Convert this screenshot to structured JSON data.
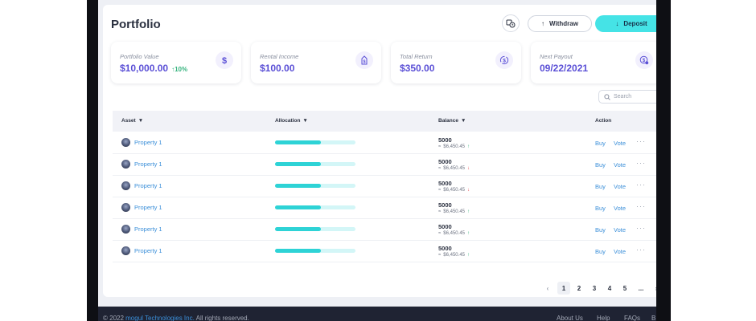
{
  "header": {
    "title": "Portfolio",
    "withdraw_label": "Withdraw",
    "deposit_label": "Deposit"
  },
  "stats": [
    {
      "label": "Portfolio Value",
      "value": "$10,000.00",
      "change": "10%",
      "icon": "dollar-icon"
    },
    {
      "label": "Rental Income",
      "value": "$100.00",
      "icon": "dollar-tag-icon"
    },
    {
      "label": "Total Return",
      "value": "$350.00",
      "icon": "dollar-cycle-icon"
    },
    {
      "label": "Next Payout",
      "value": "09/22/2021",
      "icon": "dollar-clock-icon"
    }
  ],
  "search": {
    "placeholder": "Search"
  },
  "table": {
    "columns": {
      "asset": "Asset",
      "allocation": "Allocation",
      "balance": "Balance",
      "action": "Action"
    },
    "buy_label": "Buy",
    "vote_label": "Vote",
    "more_label": "···",
    "rows": [
      {
        "asset": "Property 1",
        "allocation": 0.57,
        "balance": "5000",
        "sub": "$6,450.45",
        "trend": "up"
      },
      {
        "asset": "Property 1",
        "allocation": 0.57,
        "balance": "5000",
        "sub": "$6,450.45",
        "trend": "down"
      },
      {
        "asset": "Property 1",
        "allocation": 0.57,
        "balance": "5000",
        "sub": "$6,450.45",
        "trend": "down"
      },
      {
        "asset": "Property 1",
        "allocation": 0.57,
        "balance": "5000",
        "sub": "$6,450.45",
        "trend": "up"
      },
      {
        "asset": "Property 1",
        "allocation": 0.57,
        "balance": "5000",
        "sub": "$6,450.45",
        "trend": "up"
      },
      {
        "asset": "Property 1",
        "allocation": 0.57,
        "balance": "5000",
        "sub": "$6,450.45",
        "trend": "up"
      }
    ]
  },
  "pagination": {
    "prev": "‹",
    "pages": [
      "1",
      "2",
      "3",
      "4",
      "5"
    ],
    "ellipsis": "...",
    "next": "›",
    "current": "1"
  },
  "footer": {
    "copy_prefix": "© 2022 ",
    "brand": "mogul Technologies Inc.",
    "copy_suffix": " All rights reserved.",
    "links": [
      "About Us",
      "Help",
      "FAQs",
      "B"
    ]
  },
  "colors": {
    "accent": "#45e3e6",
    "primary_text": "#5a4fd6",
    "link": "#3b8fd9",
    "up": "#36b37e",
    "down": "#e5484d"
  }
}
